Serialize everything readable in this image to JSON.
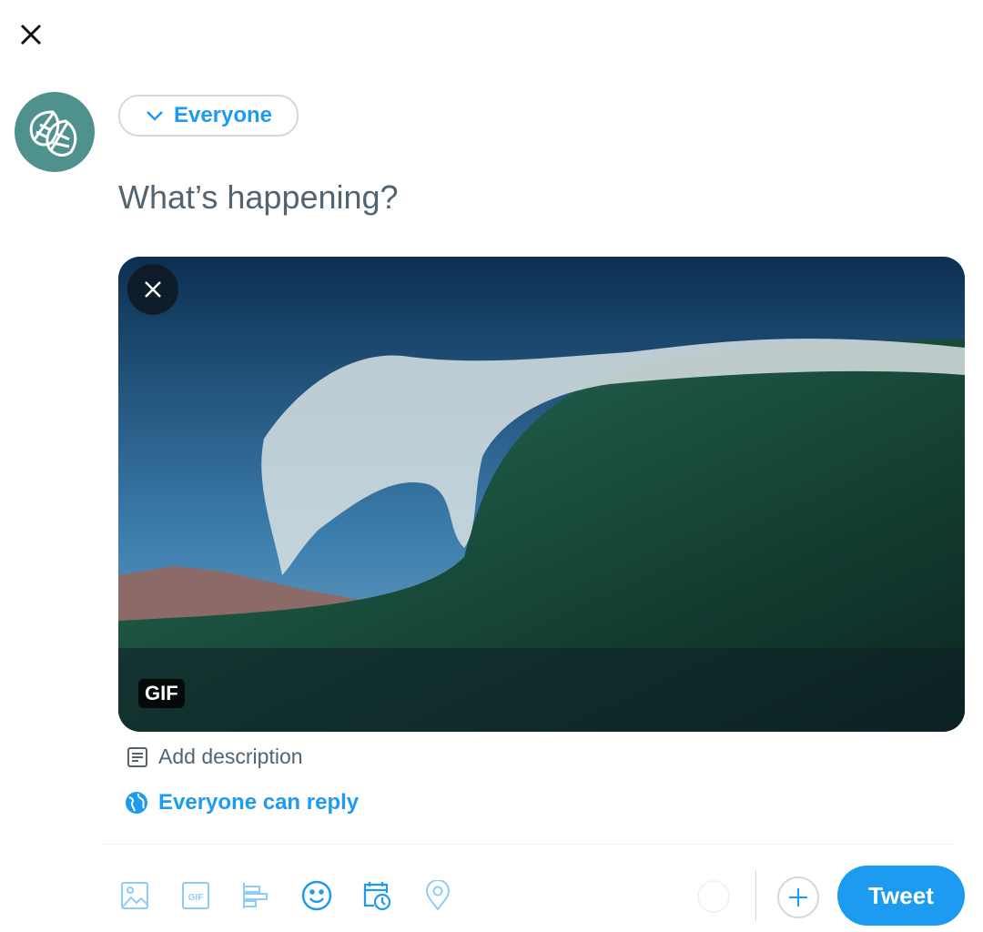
{
  "header": {
    "close_icon": "close-icon"
  },
  "composer": {
    "audience_label": "Everyone",
    "placeholder": "What’s happening?",
    "media": {
      "badge": "GIF",
      "remove_icon": "close-icon"
    },
    "add_description": "Add description",
    "reply_setting": "Everyone can reply"
  },
  "toolbar": {
    "icons": [
      "image-icon",
      "gif-icon",
      "poll-icon",
      "emoji-icon",
      "schedule-icon",
      "location-icon"
    ],
    "tweet_label": "Tweet"
  },
  "colors": {
    "accent": "#1d9bf0",
    "avatar": "#4f918c",
    "muted": "#536471"
  }
}
